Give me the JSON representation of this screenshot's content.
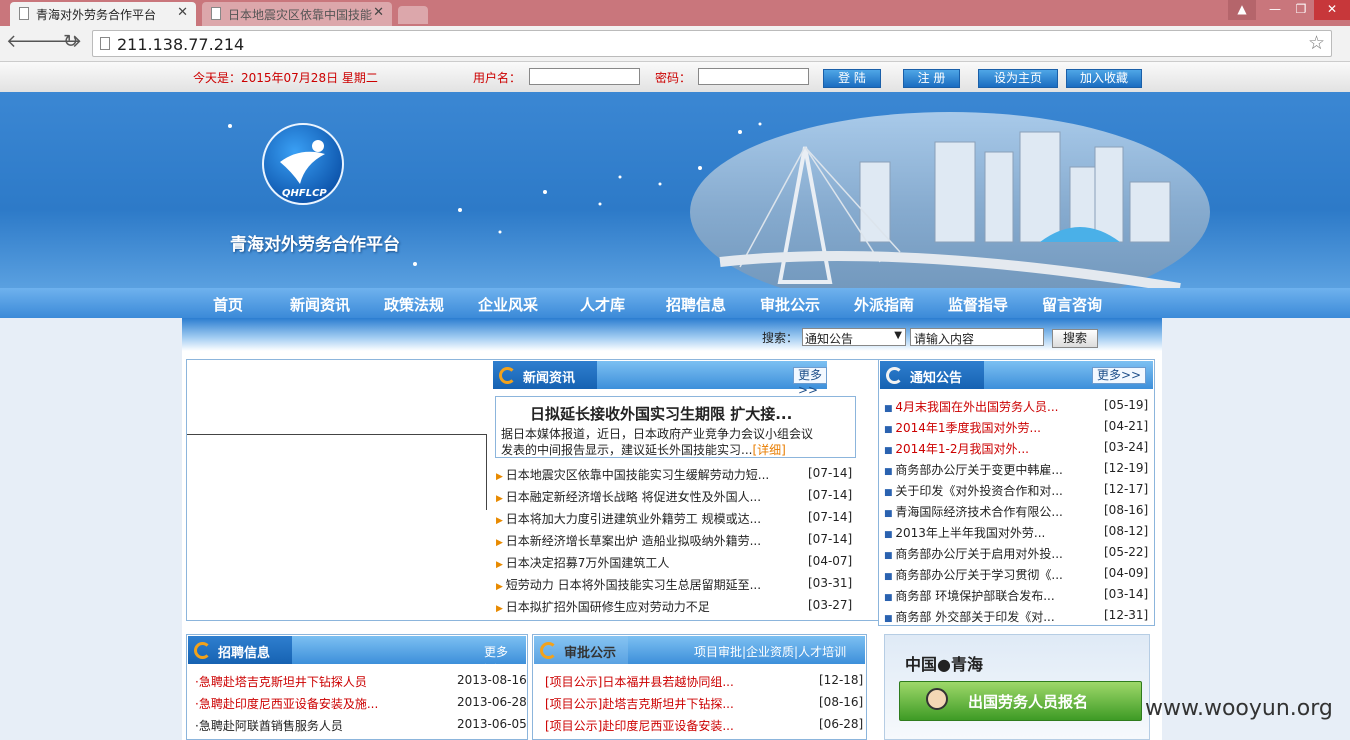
{
  "browser": {
    "tabs": [
      {
        "label": "青海对外劳务合作平台"
      },
      {
        "label": "日本地震灾区依靠中国技能"
      }
    ],
    "close_glyph": "✕",
    "url": "211.138.77.214",
    "window_buttons": [
      "▲",
      "—",
      "❐",
      "✕"
    ],
    "nav_icons": [
      "back-icon",
      "forward-icon",
      "reload-icon"
    ]
  },
  "topbar": {
    "date": "今天是：2015年07月28日 星期二",
    "username_label": "用户名：",
    "password_label": "密码：",
    "login": "登 陆",
    "register": "注 册",
    "set_home": "设为主页",
    "add_fav": "加入收藏"
  },
  "banner": {
    "logo_text": "QHFLCP",
    "site_title": "青海对外劳务合作平台"
  },
  "nav": [
    "首页",
    "新闻资讯",
    "政策法规",
    "企业风采",
    "人才库",
    "招聘信息",
    "审批公示",
    "外派指南",
    "监督指导",
    "留言咨询"
  ],
  "search": {
    "label": "搜索：",
    "selected": "通知公告",
    "placeholder": "请输入内容",
    "button": "搜索"
  },
  "news": {
    "title": "新闻资讯",
    "more": "更多>>",
    "headline": "日拟延长接收外国实习生期限 扩大接...",
    "summary_line1": "据日本媒体报道，近日，日本政府产业竞争力会议小组会议",
    "summary_line2": "发表的中间报告显示，建议延长外国技能实习...",
    "detail": "[详细]",
    "items": [
      {
        "text": "日本地震灾区依靠中国技能实习生缓解劳动力短...",
        "date": "[07-14]"
      },
      {
        "text": "日本融定新经济增长战略 将促进女性及外国人...",
        "date": "[07-14]"
      },
      {
        "text": "日本将加大力度引进建筑业外籍劳工 规模或达...",
        "date": "[07-14]"
      },
      {
        "text": "日本新经济增长草案出炉 造船业拟吸纳外籍劳...",
        "date": "[07-14]"
      },
      {
        "text": "日本决定招募7万外国建筑工人",
        "date": "[04-07]"
      },
      {
        "text": "短劳动力 日本将外国技能实习生总居留期延至...",
        "date": "[03-31]"
      },
      {
        "text": "日本拟扩招外国研修生应对劳动力不足",
        "date": "[03-27]"
      }
    ]
  },
  "notice": {
    "title": "通知公告",
    "more": "更多>>",
    "items": [
      {
        "text": "4月末我国在外出国劳务人员...",
        "date": "[05-19]",
        "red": true
      },
      {
        "text": "2014年1季度我国对外劳...",
        "date": "[04-21]",
        "red": true
      },
      {
        "text": "2014年1-2月我国对外...",
        "date": "[03-24]",
        "red": true
      },
      {
        "text": "商务部办公厅关于变更中韩雇...",
        "date": "[12-19]",
        "red": false
      },
      {
        "text": "关于印发《对外投资合作和对...",
        "date": "[12-17]",
        "red": false
      },
      {
        "text": "青海国际经济技术合作有限公...",
        "date": "[08-16]",
        "red": false
      },
      {
        "text": "2013年上半年我国对外劳...",
        "date": "[08-12]",
        "red": false
      },
      {
        "text": "商务部办公厅关于启用对外投...",
        "date": "[05-22]",
        "red": false
      },
      {
        "text": "商务部办公厅关于学习贯彻《...",
        "date": "[04-09]",
        "red": false
      },
      {
        "text": "商务部 环境保护部联合发布...",
        "date": "[03-14]",
        "red": false
      },
      {
        "text": "商务部 外交部关于印发《对...",
        "date": "[12-31]",
        "red": false
      }
    ]
  },
  "recruit": {
    "title": "招聘信息",
    "more": "更多>>",
    "items": [
      {
        "text": "·急聘赴塔吉克斯坦井下钻探人员",
        "date": "2013-08-16",
        "red": true
      },
      {
        "text": "·急聘赴印度尼西亚设备安装及施...",
        "date": "2013-06-28",
        "red": true
      },
      {
        "text": "·急聘赴阿联酋销售服务人员",
        "date": "2013-06-05",
        "red": false
      }
    ]
  },
  "approval": {
    "title": "审批公示",
    "links": "项目审批|企业资质|人才培训",
    "items": [
      {
        "text": "[项目公示]日本福井县若越协同组...",
        "date": "[12-18]"
      },
      {
        "text": "[项目公示]赴塔吉克斯坦井下钻探...",
        "date": "[08-16]"
      },
      {
        "text": "[项目公示]赴印度尼西亚设备安装...",
        "date": "[06-28]"
      }
    ]
  },
  "promo": {
    "heading": "中国●青海",
    "button": "出国劳务人员报名"
  },
  "watermark": "www.wooyun.org",
  "colors": {
    "accent": "#2d7ac8",
    "red": "#cc0000",
    "orange": "#f3a21b",
    "tabbar": "#c9767c"
  }
}
